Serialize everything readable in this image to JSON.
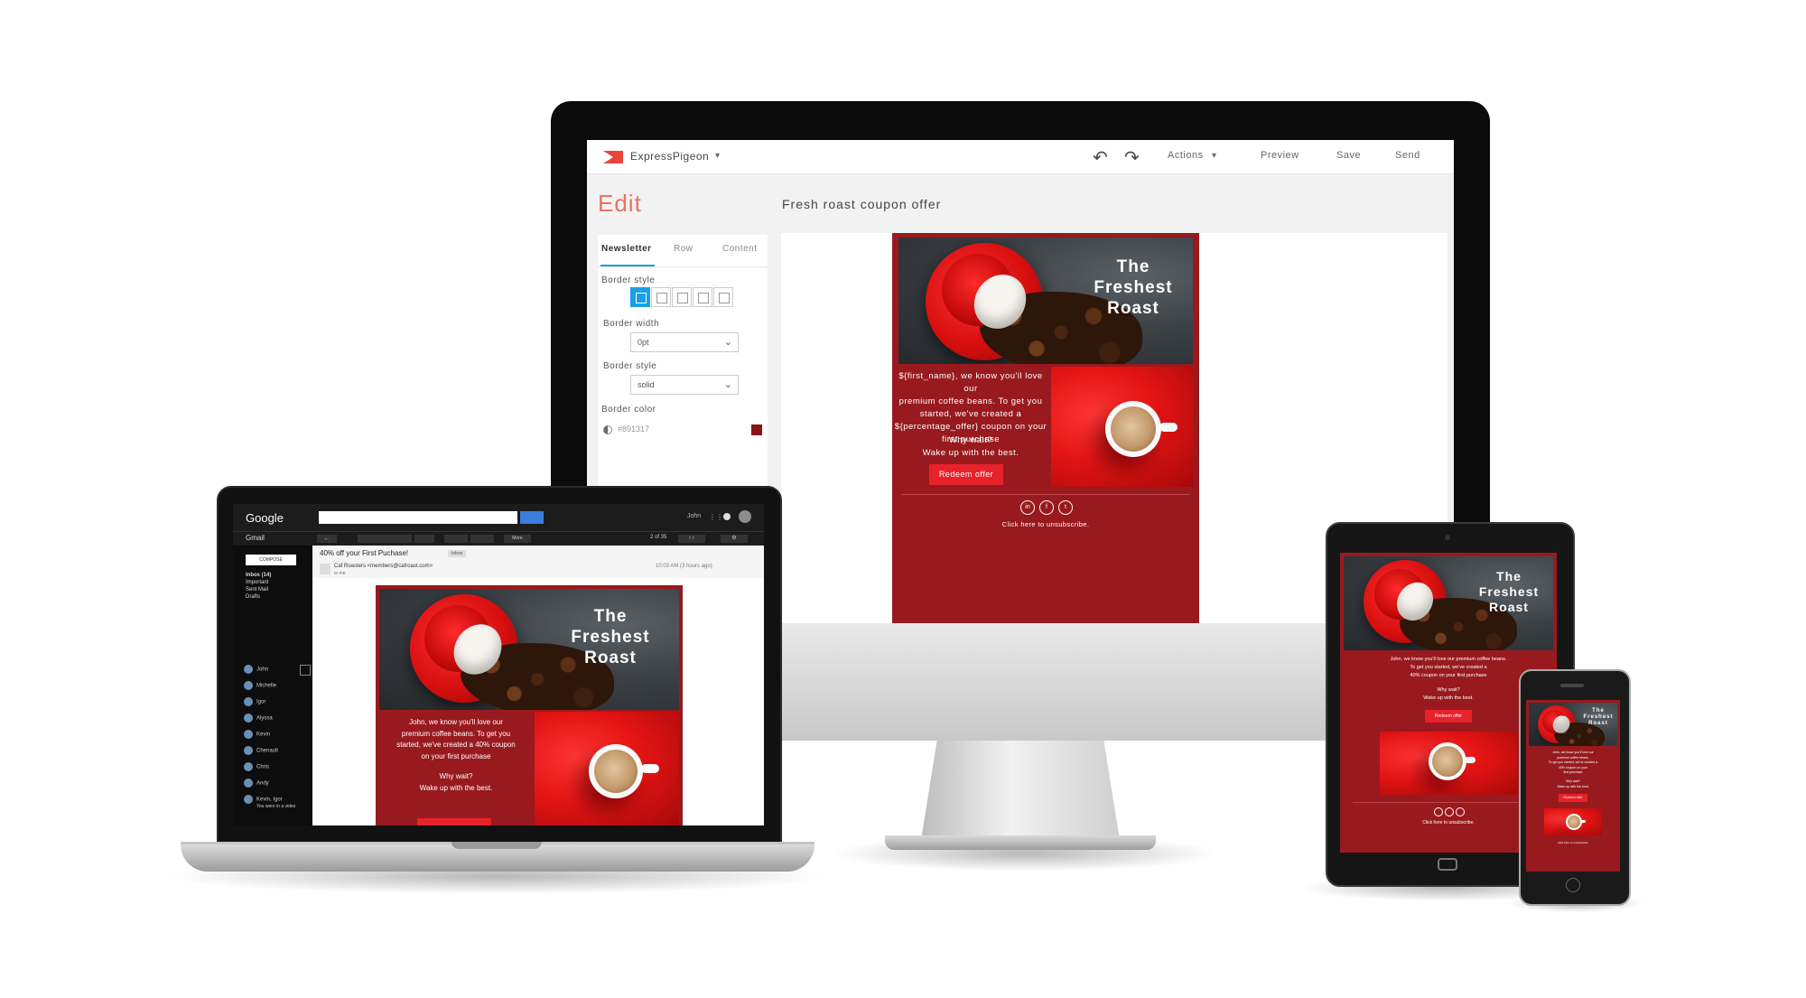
{
  "app": {
    "brand": "ExpressPigeon",
    "nav": [
      "Actions",
      "Preview",
      "Save",
      "Send"
    ],
    "edit_heading": "Edit",
    "document_title": "Fresh roast coupon offer"
  },
  "panel": {
    "tabs": [
      "Newsletter",
      "Row",
      "Content"
    ],
    "border_style_label": "Border style",
    "border_width_label": "Border width",
    "border_width_value": "0pt",
    "border_style2_label": "Border style",
    "border_style2_value": "solid",
    "border_color_label": "Border color",
    "border_color_value": "#891317"
  },
  "email": {
    "hero_title": [
      "The",
      "Freshest",
      "Roast"
    ],
    "body_lines": [
      "${first_name}, we know you'll love our",
      "premium coffee beans. To get you",
      "started, we've created a",
      "${percentage_offer} coupon on your",
      "first purchase"
    ],
    "cta_lines": [
      "Why wait?",
      "Wake up with the best."
    ],
    "button": "Redeem offer",
    "social": [
      "in",
      "f",
      "t"
    ],
    "unsubscribe": "Click here to unsubscribe."
  },
  "gmail": {
    "logo": "Google",
    "label": "Gmail",
    "compose": "COMPOSE",
    "folders": [
      "Inbox (14)",
      "Important",
      "Sent Mail",
      "Drafts"
    ],
    "contacts": [
      "John",
      "Michelle",
      "Igor",
      "Alyssa",
      "Kevin",
      "Chenault",
      "Chris",
      "Andy",
      "Kevin, Igor"
    ],
    "contacts_note": "You were in a video",
    "user": "John",
    "paging": "2 of 35",
    "more": "More",
    "inbox_tag": "Inbox",
    "subject": "40% off your First Puchase!",
    "from": "Caf Roasters <members@cafroast.com>",
    "to": "to me",
    "date": "10:03 AM (3 hours ago)",
    "body_lines": [
      "John, we know you'll love our",
      "premium coffee beans. To get you",
      "started, we've created a 40% coupon",
      "on your first purchase"
    ],
    "cta_lines": [
      "Why wait?",
      "Wake up with the best."
    ]
  },
  "tablet": {
    "body_lines": [
      "John, we know you'll love our premium coffee beans.",
      "To get you started, we've created a",
      "40% coupon on your first purchase"
    ],
    "cta_lines": [
      "Why wait?",
      "Wake up with the best."
    ],
    "button": "Redeem offer",
    "unsubscribe": "Click here to unsubscribe."
  },
  "phone": {
    "body_lines": [
      "John, we know you'll love our",
      "premium coffee beans.",
      "To get you started, we've created a",
      "40% coupon on your",
      "first purchase"
    ],
    "cta_lines": [
      "Why wait?",
      "Wake up with the best."
    ],
    "button": "Redeem offer",
    "unsubscribe": "Click here to unsubscribe."
  }
}
